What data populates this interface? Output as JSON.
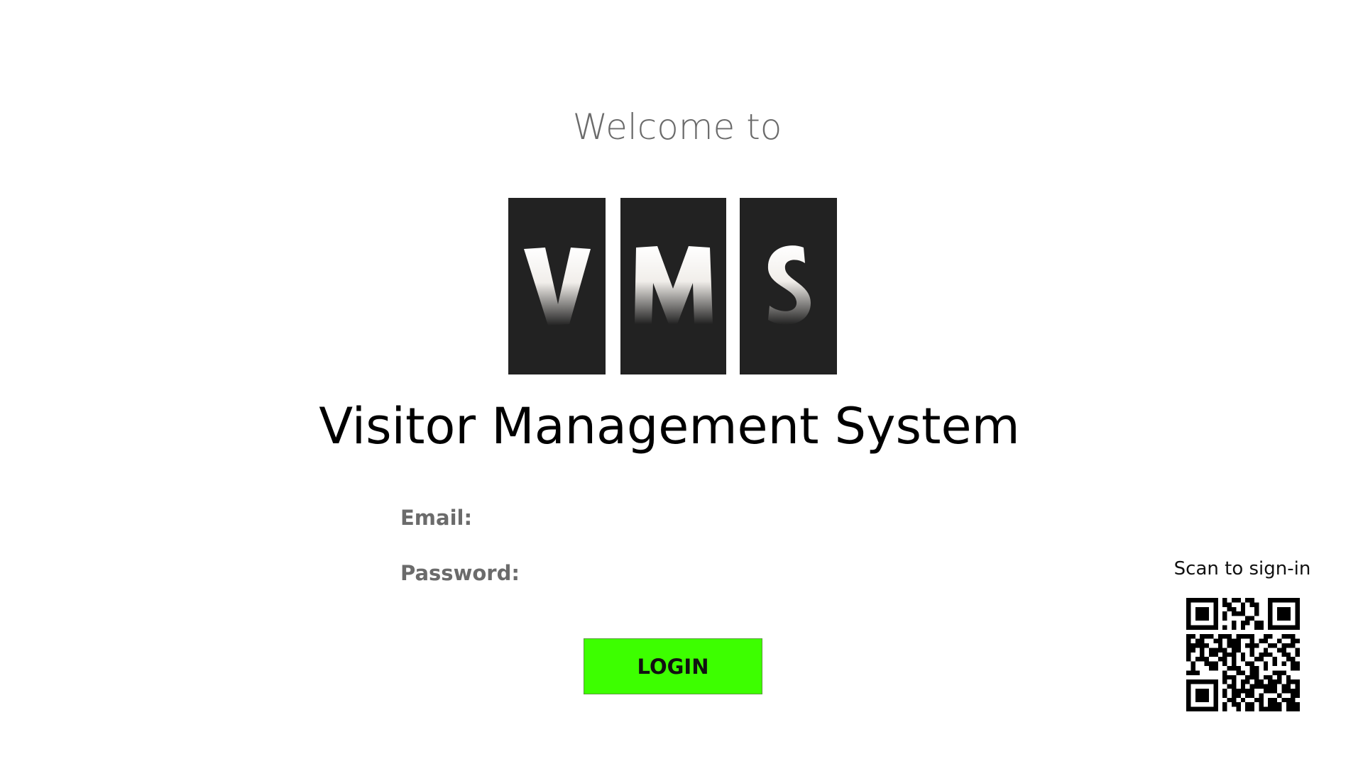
{
  "welcome": {
    "text": "Welcome to"
  },
  "logo": {
    "letters": [
      "V",
      "M",
      "S"
    ],
    "tile_color": "#222222"
  },
  "title": {
    "text": "Visitor Management System"
  },
  "form": {
    "email_label": "Email:",
    "email_value": "",
    "password_label": "Password:",
    "password_value": "",
    "login_label": "LOGIN",
    "login_color": "#3dff00"
  },
  "qr": {
    "label": "Scan to sign-in",
    "icon": "qr-code-icon"
  }
}
